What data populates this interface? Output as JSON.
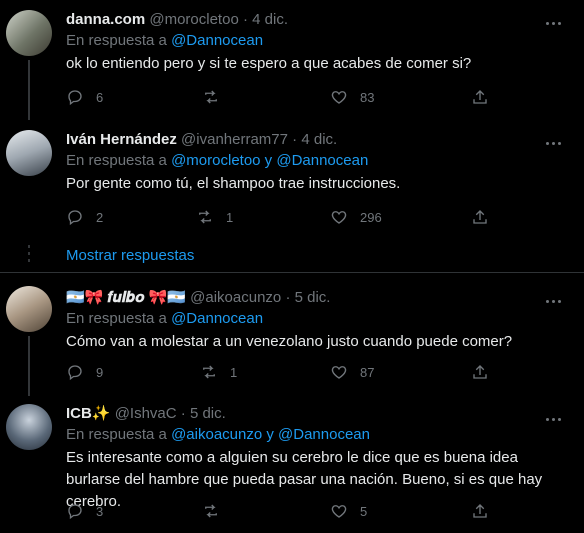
{
  "tweets": [
    {
      "name": "danna.com",
      "handle": "@morocletoo",
      "date": "4 dic.",
      "reply_prefix": "En respuesta a",
      "reply_to": "@Dannocean",
      "text": "ok lo entiendo pero y si te espero a que acabes de comer si?",
      "replies": "6",
      "retweets": "",
      "likes": "83"
    },
    {
      "name": "Iván Hernández",
      "handle": "@ivanherram77",
      "date": "4 dic.",
      "reply_prefix": "En respuesta a",
      "reply_to": "@morocletoo y @Dannocean",
      "text": "Por gente como tú, el shampoo trae instrucciones.",
      "replies": "2",
      "retweets": "1",
      "likes": "296"
    },
    {
      "name": "🇦🇷🎀 𝒇𝒖𝒍𝒃𝒐 🎀🇦🇷",
      "handle": "@aikoacunzo",
      "date": "5 dic.",
      "reply_prefix": "En respuesta a",
      "reply_to": "@Dannocean",
      "text": "Cómo van a molestar a un venezolano justo cuando puede comer?",
      "replies": "9",
      "retweets": "1",
      "likes": "87"
    },
    {
      "name": "ICB✨",
      "handle": "@IshvaC",
      "date": "5 dic.",
      "reply_prefix": "En respuesta a",
      "reply_to": "@aikoacunzo y @Dannocean",
      "text": "Es interesante como a alguien su cerebro le dice que es buena idea burlarse del hambre que pueda pasar una nación. Bueno, si es que hay cerebro.",
      "replies": "3",
      "retweets": "",
      "likes": "5"
    }
  ],
  "show_replies": "Mostrar respuestas",
  "separator": "·",
  "colors": {
    "background": "#000000",
    "text": "#e7e9ea",
    "muted": "#71767b",
    "link": "#1d9bf0",
    "border": "#2f3336"
  }
}
